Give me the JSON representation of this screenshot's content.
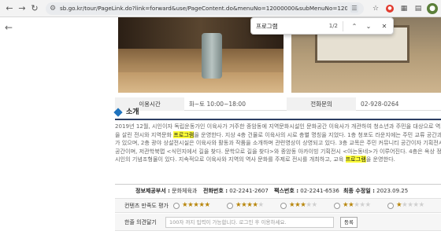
{
  "browser": {
    "url": "sb.go.kr/tour/PageLink.do?link=forward&use/PageContent.do&menuNo=12000000&subMenuNo=12030000&thirdMenuN...",
    "back_icon": "arrow-left-icon",
    "forward_icon": "arrow-right-icon",
    "reload_icon": "reload-icon",
    "home_icon": "home-icon"
  },
  "find": {
    "query": "프로그램",
    "count": "1/2"
  },
  "info": {
    "hours_label": "이용시간",
    "hours_value": "화~토 10:00~18:00",
    "phone_label": "전화문의",
    "phone_value": "02-928-0264"
  },
  "section": {
    "title": "소개"
  },
  "body": {
    "lines": [
      [
        "2019년 12월, 시인이자 독립운동가인 이육사가 거주한 종암동에 지역문화시설인 문화공간 이육사가 개관하여 청소년과 주민을 대상으로 역사",
        "",
        ""
      ],
      [
        "을 살린 전시와 지역문화 ",
        "프로그램",
        "을 운영한다. 지상 4층 건물로 이육사의 시로 층별 명칭을 지었다. 1층 청포도 라운지에는 주민 교류 공간과 안"
      ],
      [
        "가 있으며, 2층 광야 상설전시실은 이육사와 활동과 작품을 소개하며 관련영상이 상영되고 있다. 3층 교목은 주민 커뮤니티 공간이자 기획전시를",
        "",
        ""
      ],
      [
        "공간이며, 저관학북맵 <식민지에서 길을 찾다. 문학으로 길을 찾다>와 종암동 아카이빙 기획전시 <아는동네>가 이루어진다. 4층은 옥상 정원으로",
        "",
        ""
      ],
      [
        "시인의 기념조형물이 있다. 지속적으로 이육사와 지역의 역사 문화를 주제로 전시를 개최하고, 교육 ",
        "프로그램",
        "을 운영한다."
      ]
    ]
  },
  "footer": {
    "dept_label": "정보제공부서 :",
    "dept_value": "문화체육과",
    "tel_label": "전화번호 :",
    "tel_value": "02-2241-2607",
    "fax_label": "팩스번호 :",
    "fax_value": "02-2241-6536",
    "updated_label": "최종 수정일 :",
    "updated_value": "2023.09.25"
  },
  "rating": {
    "label": "컨텐츠 만족도 평가",
    "options": [
      5,
      4,
      3,
      2,
      1
    ],
    "max": 5,
    "star_color": "#b8860b"
  },
  "comment": {
    "label": "한줄 의견달기",
    "placeholder": "100자 까지 입력이 가능합니다. 로그인 후 이용하세요.",
    "submit": "등록"
  },
  "colors": {
    "accent": "#1e73be",
    "rule": "#2c3e63",
    "highlight_active": "#ff9632",
    "highlight": "#ffff38"
  }
}
